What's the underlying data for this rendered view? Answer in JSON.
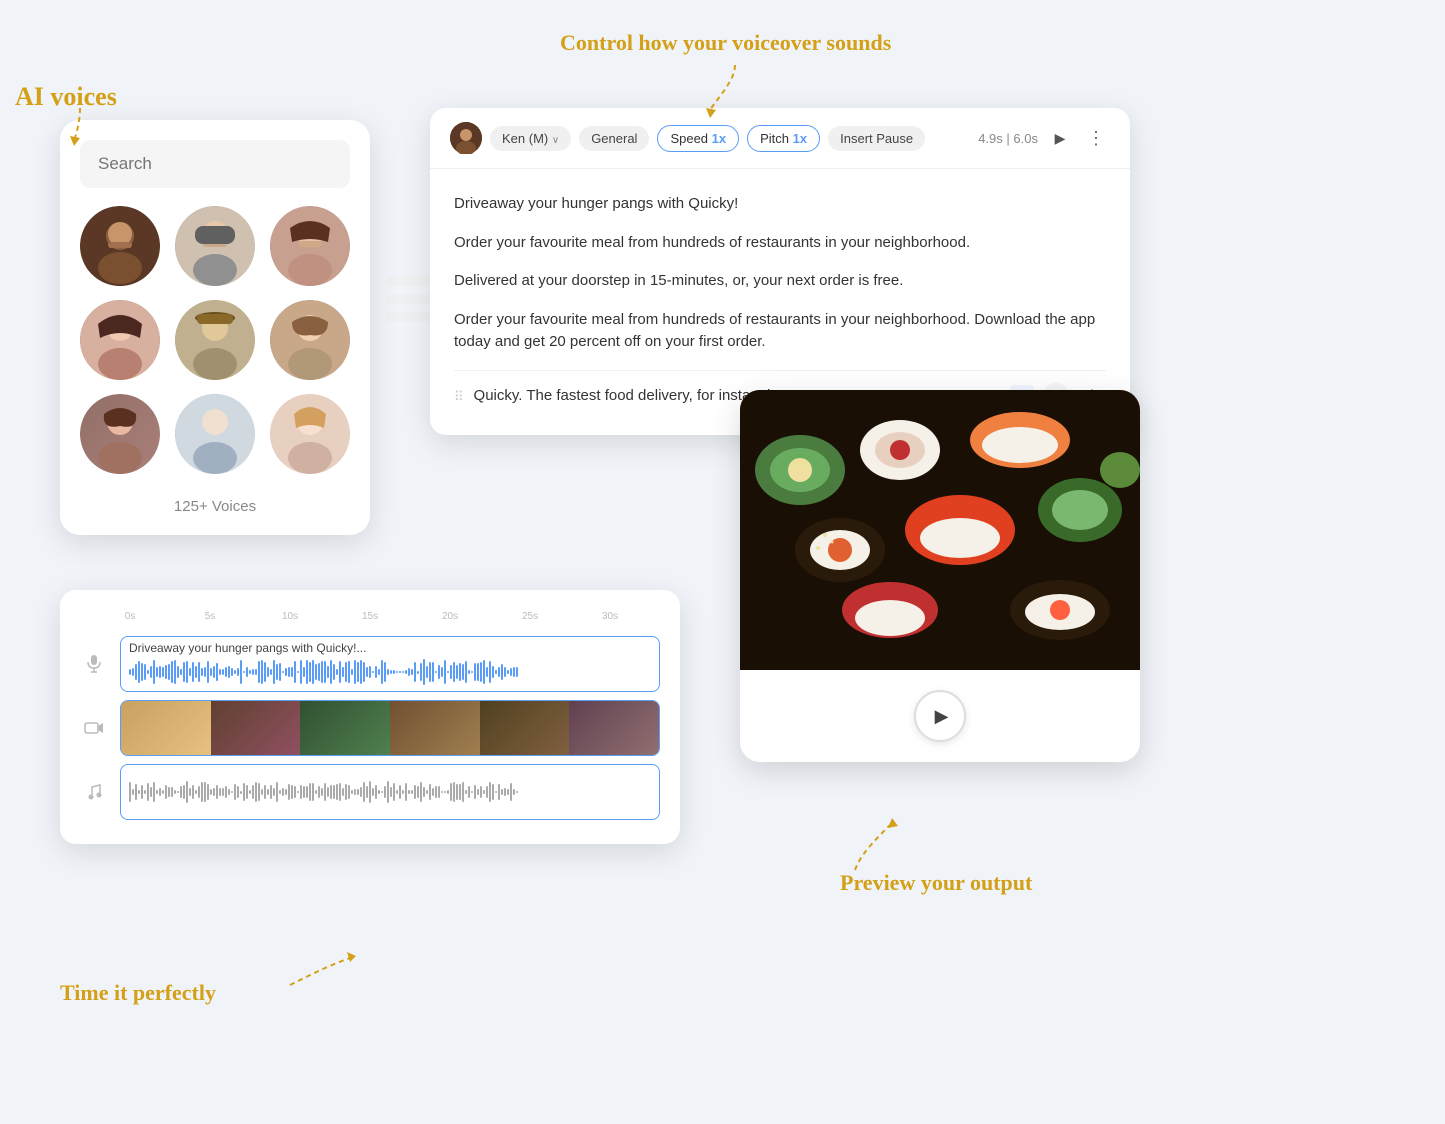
{
  "annotations": {
    "ai_voices": "AI voices",
    "control_voiceover": "Control how your voiceover sounds",
    "time_perfectly": "Time it perfectly",
    "preview_output": "Preview your output"
  },
  "voice_panel": {
    "search_placeholder": "Search",
    "voices_count": "125+ Voices",
    "voices": [
      {
        "id": 1,
        "emoji": "👨🏿",
        "color": "avatar-1"
      },
      {
        "id": 2,
        "emoji": "👨",
        "color": "avatar-2"
      },
      {
        "id": 3,
        "emoji": "👩",
        "color": "avatar-3"
      },
      {
        "id": 4,
        "emoji": "👩🏻",
        "color": "avatar-4"
      },
      {
        "id": 5,
        "emoji": "👨🎩",
        "color": "avatar-5"
      },
      {
        "id": 6,
        "emoji": "👩🏼",
        "color": "avatar-6"
      },
      {
        "id": 7,
        "emoji": "👩🏽",
        "color": "avatar-7"
      },
      {
        "id": 8,
        "emoji": "👨🏼",
        "color": "avatar-8"
      },
      {
        "id": 9,
        "emoji": "👩🏼🦱",
        "color": "avatar-9"
      }
    ]
  },
  "controls": {
    "speaker_name": "Ken (M)",
    "style": "General",
    "speed_label": "Speed",
    "speed_value": "1x",
    "pitch_label": "Pitch",
    "pitch_value": "1x",
    "insert_pause": "Insert Pause",
    "time1": "4.9s",
    "separator": "|",
    "time2": "6.0s"
  },
  "script": {
    "line1": "Driveaway your hunger pangs with Quicky!",
    "line2": "Order your favourite meal from hundreds of restaurants in your neighborhood.",
    "line3": "Delivered at your doorstep in 15-minutes, or, your next order is free.",
    "line4": "Order your favourite meal from hundreds of restaurants in your neighborhood. Download the app today and get 20 percent off on your first order.",
    "line5": "Quicky. The fastest food delivery, for instant hunger."
  },
  "timeline": {
    "ruler_ticks": [
      "0s",
      "5s",
      "10s",
      "15s",
      "20s",
      "25s",
      "30s"
    ],
    "voice_track_label": "Driveaway your hunger pangs with Quicky!...",
    "icons": {
      "mic": "🎙",
      "video": "🎬",
      "music": "🎵"
    }
  },
  "preview": {
    "play_label": "▶"
  }
}
